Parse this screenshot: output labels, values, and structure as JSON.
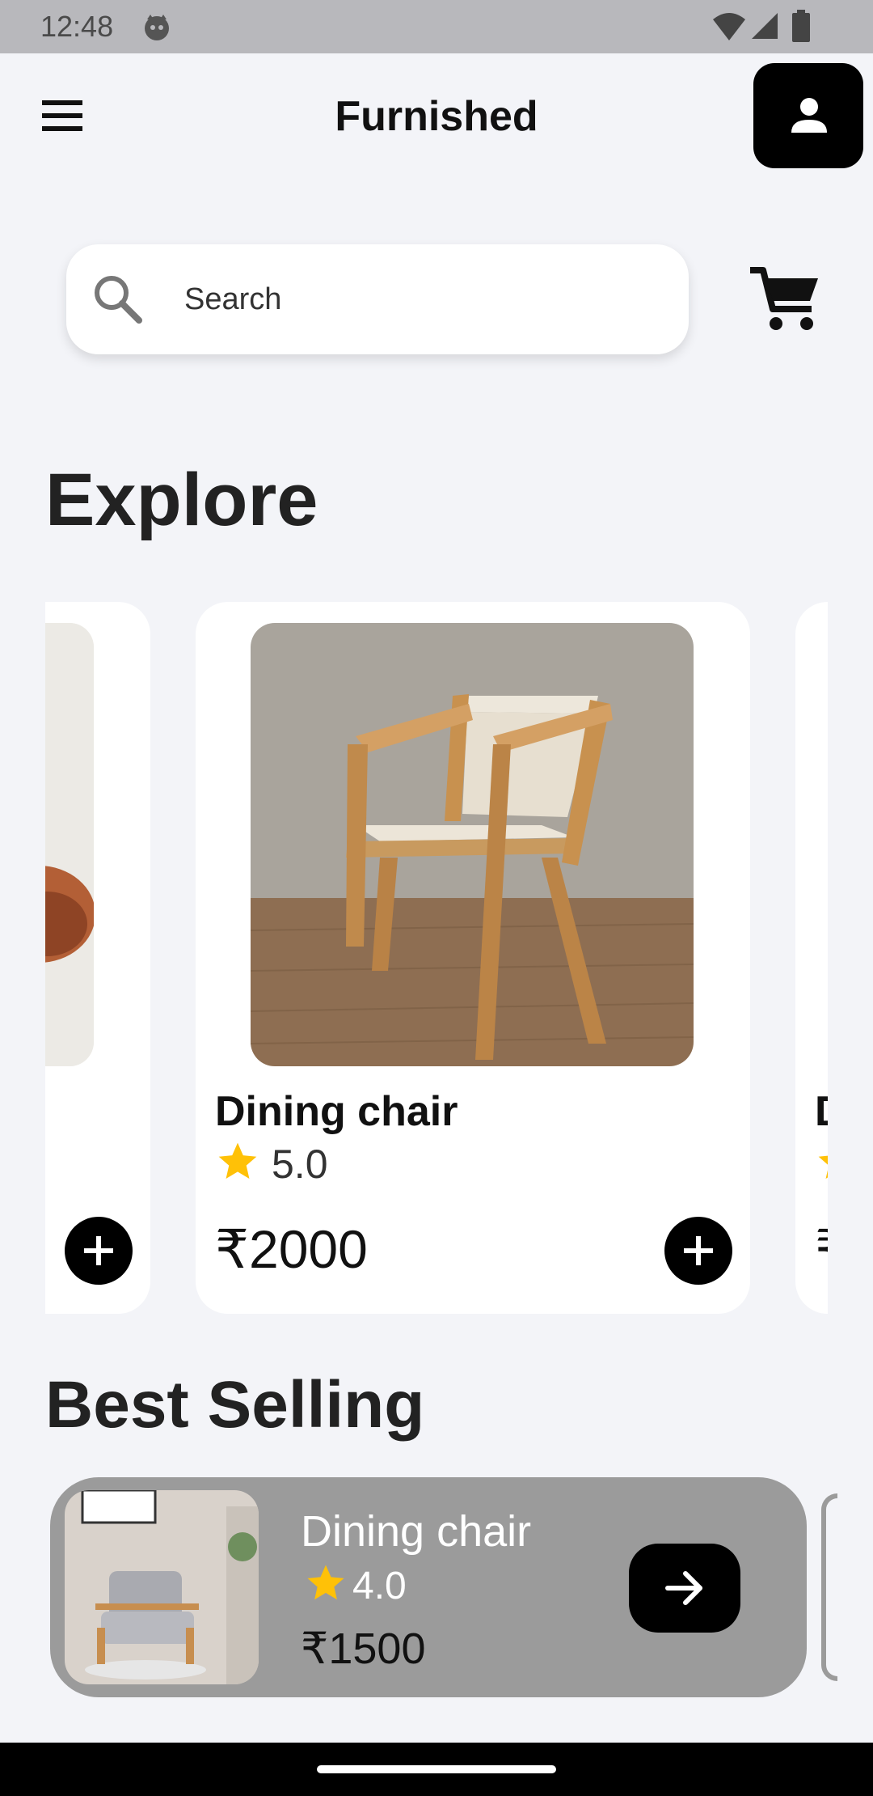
{
  "status_bar": {
    "time": "12:48",
    "icons": [
      "cat-icon",
      "wifi-icon",
      "signal-icon",
      "battery-icon"
    ]
  },
  "app_bar": {
    "title": "Furnished",
    "menu_icon": "menu-icon",
    "profile_icon": "person-icon"
  },
  "search": {
    "placeholder": "Search",
    "icon": "search-icon"
  },
  "cart": {
    "icon": "cart-icon"
  },
  "explore": {
    "heading": "Explore",
    "cards": [
      {
        "title": "",
        "rating": "",
        "price": "",
        "image": "lounge-chair"
      },
      {
        "title": "Dining chair",
        "rating": "5.0",
        "price": "₹2000",
        "image": "wooden-dining-chair"
      },
      {
        "title": "D",
        "rating": "",
        "price": "₹",
        "image": ""
      }
    ]
  },
  "best_selling": {
    "heading": "Best Selling",
    "items": [
      {
        "title": "Dining chair",
        "rating": "4.0",
        "price": "₹1500",
        "image": "armchair"
      }
    ]
  },
  "colors": {
    "accent_black": "#000000",
    "star": "#FFC107",
    "background": "#F3F4F8",
    "best_card": "#9B9B9B"
  }
}
